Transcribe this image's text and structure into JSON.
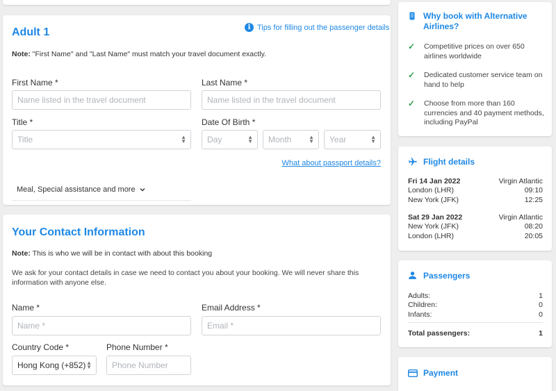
{
  "adult": {
    "title": "Adult 1",
    "tips_link": "Tips for filling out the passenger details",
    "note_label": "Note:",
    "note_text": " \"First Name\" and \"Last Name\" must match your travel document exactly.",
    "first_name_label": "First Name *",
    "first_name_placeholder": "Name listed in the travel document",
    "last_name_label": "Last Name *",
    "last_name_placeholder": "Name listed in the travel document",
    "title_label": "Title *",
    "title_placeholder": "Title",
    "dob_label": "Date Of Birth *",
    "dob_day": "Day",
    "dob_month": "Month",
    "dob_year": "Year",
    "passport_link": "What about passport details?",
    "meal_toggle": "Meal, Special assistance and more"
  },
  "contact": {
    "title": "Your Contact Information",
    "note_label": "Note:",
    "note_text": " This is who we will be in contact with about this booking",
    "paragraph": "We ask for your contact details in case we need to contact you about your booking. We will never share this information with anyone else.",
    "name_label": "Name *",
    "name_placeholder": "Name *",
    "email_label": "Email Address *",
    "email_placeholder": "Email *",
    "country_label": "Country Code *",
    "country_value": "Hong Kong (+852)",
    "phone_label": "Phone Number *",
    "phone_placeholder": "Phone Number"
  },
  "why": {
    "title": "Why book with Alternative Airlines?",
    "items": [
      "Competitive prices on over 650 airlines worldwide",
      "Dedicated customer service team on hand to help",
      "Choose from more than 160 currencies and 40 payment methods, including PayPal"
    ]
  },
  "flight": {
    "title": "Flight details",
    "legs": [
      {
        "date": "Fri 14 Jan 2022",
        "airline": "Virgin Atlantic",
        "from": "London (LHR)",
        "dep": "09:10",
        "to": "New York (JFK)",
        "arr": "12:25"
      },
      {
        "date": "Sat 29 Jan 2022",
        "airline": "Virgin Atlantic",
        "from": "New York (JFK)",
        "dep": "08:20",
        "to": "London (LHR)",
        "arr": "20:05"
      }
    ]
  },
  "passengers": {
    "title": "Passengers",
    "rows": [
      {
        "label": "Adults:",
        "value": "1"
      },
      {
        "label": "Children:",
        "value": "0"
      },
      {
        "label": "Infants:",
        "value": "0"
      }
    ],
    "total_label": "Total passengers:",
    "total_value": "1"
  },
  "payment": {
    "title": "Payment"
  },
  "colors": {
    "accent": "#1e88e5",
    "check": "#2e9e48",
    "background": "#eeeeee"
  },
  "icons": [
    "info-icon",
    "chevron-down-icon",
    "select-caret-icon",
    "phone-icon",
    "check-icon",
    "plane-icon",
    "person-icon",
    "card-icon"
  ]
}
